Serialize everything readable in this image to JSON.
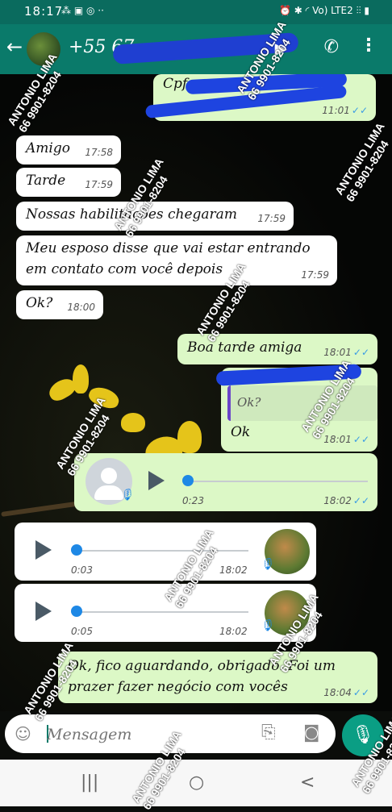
{
  "status_bar": {
    "time": "18:17",
    "left_icons": "⁂ ▣ ◎ ··",
    "right_icons": "⏰ ✱ ◜ Vo) LTE2 ⫶⫶ ▮"
  },
  "header": {
    "contact": "+55 67",
    "back_icon": "arrow-left-icon",
    "video_icon": "video-camera-icon",
    "call_icon": "phone-icon",
    "more_icon": "more-vertical-icon"
  },
  "messages": [
    {
      "id": "m1",
      "dir": "out",
      "text": "Cpf:",
      "time": "11:01",
      "status": "read"
    },
    {
      "id": "m2",
      "dir": "in",
      "text": "Amigo",
      "time": "17:58"
    },
    {
      "id": "m3",
      "dir": "in",
      "text": "Tarde",
      "time": "17:59"
    },
    {
      "id": "m4",
      "dir": "in",
      "text": "Nossas habilitações chegaram",
      "time": "17:59"
    },
    {
      "id": "m5",
      "dir": "in",
      "text_line1": "Meu esposo disse que vai estar entrando",
      "text_line2": "em contato com você depois",
      "time": "17:59"
    },
    {
      "id": "m6",
      "dir": "in",
      "text": "Ok?",
      "time": "18:00"
    },
    {
      "id": "m7",
      "dir": "out",
      "text": "Boa tarde amiga",
      "time": "18:01",
      "status": "read"
    },
    {
      "id": "m8",
      "dir": "out",
      "quoted": "Ok?",
      "text": "Ok",
      "time": "18:01",
      "status": "read"
    },
    {
      "id": "m9",
      "dir": "out",
      "type": "audio",
      "duration": "0:23",
      "time": "18:02",
      "status": "read",
      "progress": 0
    },
    {
      "id": "m10",
      "dir": "in",
      "type": "audio",
      "duration": "0:03",
      "time": "18:02",
      "progress": 0
    },
    {
      "id": "m11",
      "dir": "in",
      "type": "audio",
      "duration": "0:05",
      "time": "18:02",
      "progress": 0
    },
    {
      "id": "m12",
      "dir": "out",
      "text_line1": "Ok, fico aguardando, obrigado. Foi um",
      "text_line2": "prazer fazer negócio com vocês",
      "time": "18:04",
      "status": "read"
    }
  ],
  "composer": {
    "placeholder": "Mensagem",
    "emoji_icon": "emoji-icon",
    "attach_icon": "paperclip-icon",
    "camera_icon": "camera-icon",
    "mic_icon": "microphone-icon"
  },
  "navbar": {
    "recent": "|||",
    "home": "○",
    "back": "<"
  },
  "watermark": {
    "line1": "ANTONIO LIMA",
    "line2": "66 9901-8204"
  },
  "colors": {
    "header": "#0a7a6a",
    "outgoing": "#dcf8c6",
    "incoming": "#ffffff",
    "read_ticks": "#3a9ce4",
    "audio_dot": "#1e88e5"
  }
}
